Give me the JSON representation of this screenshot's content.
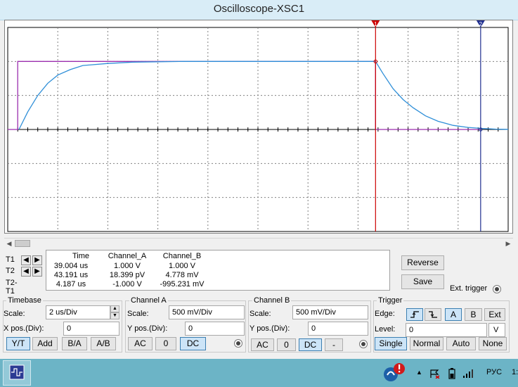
{
  "window": {
    "title": "Oscilloscope-XSC1"
  },
  "cursors": {
    "t1_label": "T1",
    "t2_label": "T2",
    "t2t1_label": "T2-T1",
    "t1_marker": "1",
    "t2_marker": "2"
  },
  "readout": {
    "headers": [
      "Time",
      "Channel_A",
      "Channel_B"
    ],
    "rows": [
      [
        "39.004 us",
        "1.000 V",
        "1.000 V"
      ],
      [
        "43.191 us",
        "18.399 pV",
        "4.778 mV"
      ],
      [
        "4.187 us",
        "-1.000 V",
        "-995.231 mV"
      ]
    ]
  },
  "buttons": {
    "reverse": "Reverse",
    "save": "Save",
    "ext_trigger": "Ext. trigger"
  },
  "timebase": {
    "title": "Timebase",
    "scale_label": "Scale:",
    "scale_value": "2 us/Div",
    "xpos_label": "X pos.(Div):",
    "xpos_value": "0",
    "modes": [
      "Y/T",
      "Add",
      "B/A",
      "A/B"
    ],
    "active_mode": "Y/T"
  },
  "channel_a": {
    "title": "Channel A",
    "scale_label": "Scale:",
    "scale_value": "500 mV/Div",
    "ypos_label": "Y pos.(Div):",
    "ypos_value": "0",
    "coupling": [
      "AC",
      "0",
      "DC"
    ],
    "active_coupling": "DC"
  },
  "channel_b": {
    "title": "Channel B",
    "scale_label": "Scale:",
    "scale_value": "500 mV/Div",
    "ypos_label": "Y pos.(Div):",
    "ypos_value": "0",
    "coupling": [
      "AC",
      "0",
      "DC",
      "-"
    ],
    "active_coupling": "DC"
  },
  "trigger": {
    "title": "Trigger",
    "edge_label": "Edge:",
    "edge_sources": [
      "A",
      "B",
      "Ext"
    ],
    "active_source": "A",
    "level_label": "Level:",
    "level_value": "0",
    "level_unit": "V",
    "modes": [
      "Single",
      "Normal",
      "Auto",
      "None"
    ],
    "active_mode": "Single"
  },
  "taskbar": {
    "language": "РУС",
    "clock_fragment": "1:"
  },
  "colors": {
    "channel_a": "#9b2fae",
    "channel_b": "#2f8fd8",
    "cursor_t1": "#cc0000",
    "cursor_t2": "#1f2e8f",
    "grid": "#808080"
  },
  "chart_data": {
    "type": "line",
    "x_unit": "us",
    "y_unit": "V",
    "xlim": [
      0,
      20
    ],
    "ylim": [
      -1.5,
      1.5
    ],
    "series": [
      {
        "name": "Channel_A",
        "points": [
          [
            0,
            0
          ],
          [
            0.4,
            0
          ],
          [
            0.4,
            1
          ],
          [
            1,
            1
          ],
          [
            5,
            1
          ],
          [
            9,
            1
          ],
          [
            13,
            1
          ],
          [
            14.7,
            1
          ],
          [
            14.7,
            0
          ],
          [
            16,
            0
          ],
          [
            18.9,
            0
          ]
        ]
      },
      {
        "name": "Channel_B",
        "points": [
          [
            0.45,
            0
          ],
          [
            0.8,
            0.26
          ],
          [
            1.2,
            0.5
          ],
          [
            1.6,
            0.68
          ],
          [
            2,
            0.8
          ],
          [
            2.5,
            0.88
          ],
          [
            3,
            0.94
          ],
          [
            4,
            0.97
          ],
          [
            5,
            0.99
          ],
          [
            7,
            1
          ],
          [
            10,
            1
          ],
          [
            13,
            1
          ],
          [
            14.7,
            1
          ],
          [
            15.0,
            0.82
          ],
          [
            15.4,
            0.6
          ],
          [
            15.8,
            0.44
          ],
          [
            16.2,
            0.32
          ],
          [
            16.7,
            0.2
          ],
          [
            17.2,
            0.12
          ],
          [
            17.8,
            0.06
          ],
          [
            18.4,
            0.03
          ],
          [
            19,
            0.015
          ],
          [
            19.5,
            0.005
          ],
          [
            20,
            0.002
          ]
        ]
      }
    ],
    "cursors": {
      "t1_x": 14.7,
      "t2_x": 18.9
    }
  }
}
